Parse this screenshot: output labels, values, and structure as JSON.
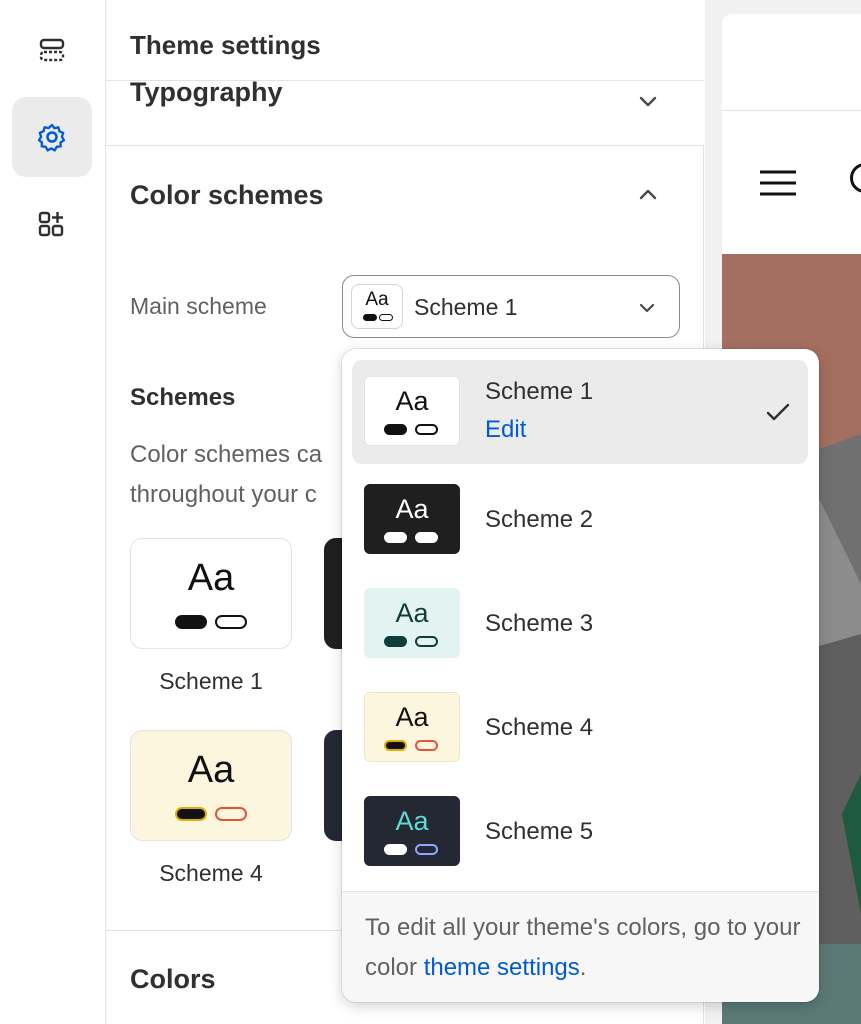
{
  "panel": {
    "title": "Theme settings",
    "typography_label": "Typography",
    "color_schemes_label": "Color schemes",
    "main_scheme_label": "Main scheme",
    "selected_scheme": "Scheme 1",
    "schemes_heading": "Schemes",
    "schemes_desc_line1": "Color schemes ca",
    "schemes_desc_line2": "throughout your c",
    "colors_label": "Colors",
    "swatch_text": "Aa"
  },
  "cards": [
    {
      "label": "Scheme 1",
      "aa": "Aa"
    },
    {
      "label": "Scheme 4",
      "aa": "Aa"
    }
  ],
  "dropdown": {
    "options": [
      {
        "name": "Scheme 1",
        "aa": "Aa",
        "selected": true
      },
      {
        "name": "Scheme 2",
        "aa": "Aa"
      },
      {
        "name": "Scheme 3",
        "aa": "Aa"
      },
      {
        "name": "Scheme 4",
        "aa": "Aa"
      },
      {
        "name": "Scheme 5",
        "aa": "Aa"
      }
    ],
    "edit_label": "Edit",
    "footer_prefix": "To edit all your theme's colors, go to your color ",
    "footer_link": "theme settings",
    "footer_suffix": "."
  },
  "icons": {
    "rail": [
      "sections-icon",
      "gear-icon",
      "apps-icon"
    ],
    "chevrons": [
      "chevron-down-icon",
      "chevron-up-icon"
    ],
    "check": "checkmark-icon",
    "menu": "hamburger-icon"
  },
  "colors": {
    "accent": "#005bd3",
    "scheme1_bg": "#ffffff",
    "scheme2_bg": "#1f1f1f",
    "scheme3_bg": "#e3f3f1",
    "scheme4_bg": "#fdf6de",
    "scheme5_bg": "#242833"
  }
}
